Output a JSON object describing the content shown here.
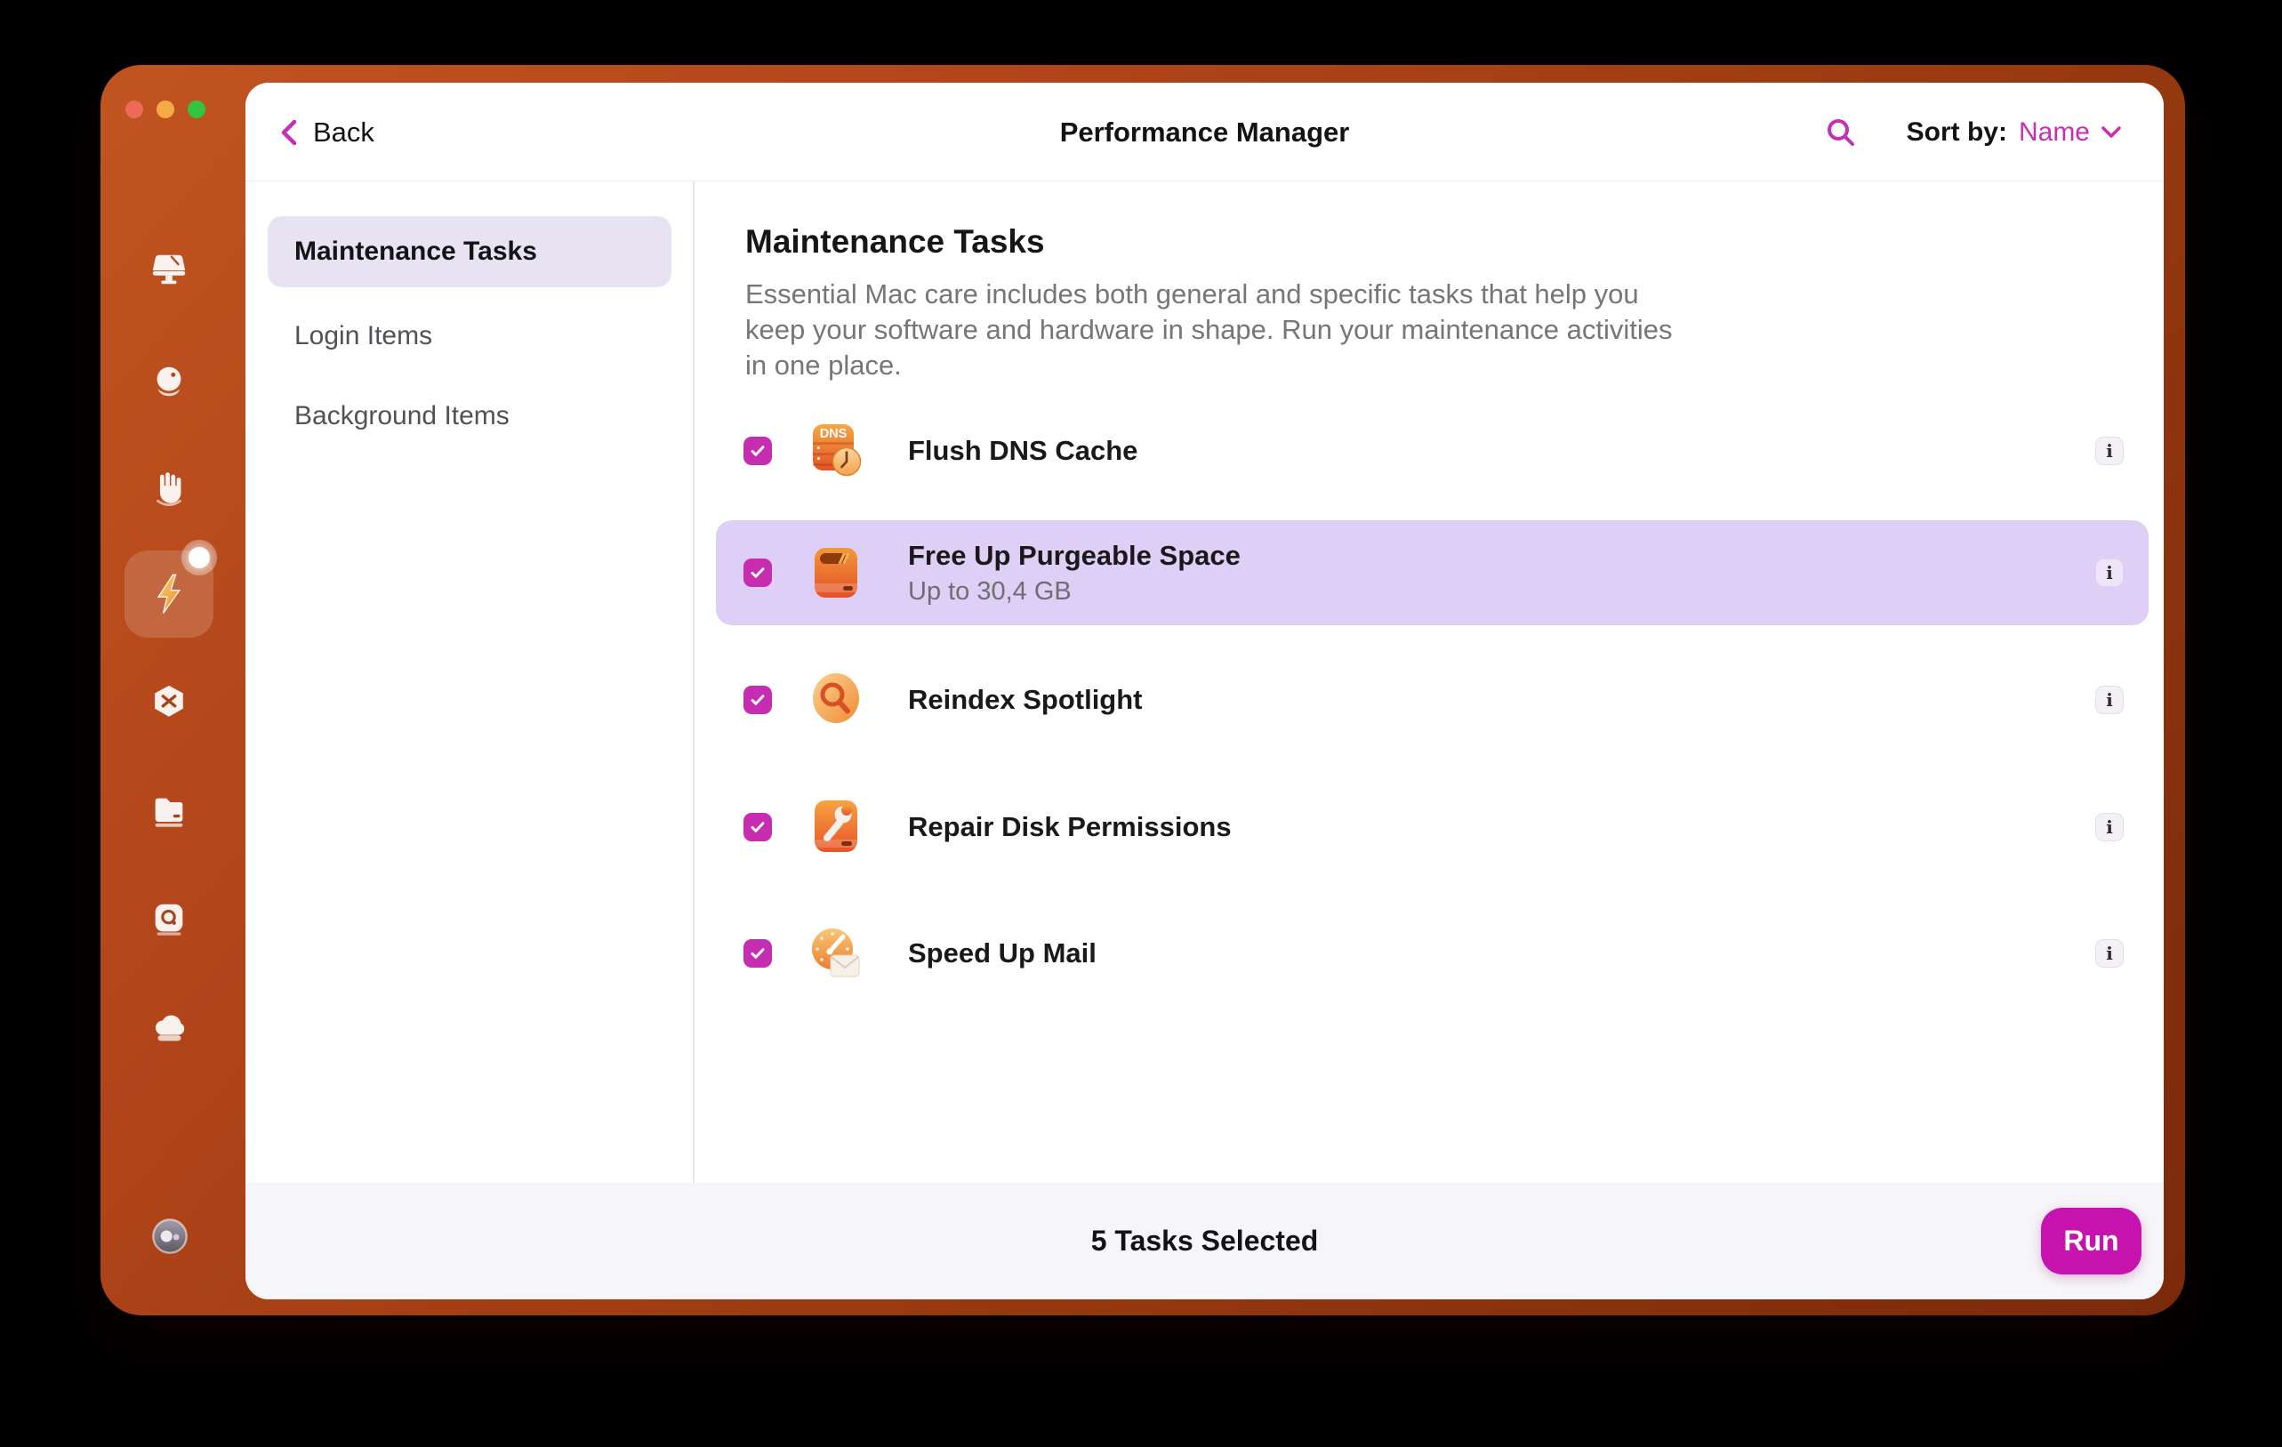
{
  "header": {
    "back_label": "Back",
    "title": "Performance Manager",
    "sort_label": "Sort by:",
    "sort_value": "Name"
  },
  "sidebar": {
    "items": [
      {
        "icon": "monitor-icon"
      },
      {
        "icon": "care-orb-icon"
      },
      {
        "icon": "protection-hand-icon"
      },
      {
        "icon": "performance-bolt-icon",
        "active": true,
        "badge": true
      },
      {
        "icon": "applications-icon"
      },
      {
        "icon": "files-folder-icon"
      },
      {
        "icon": "media-viewer-icon"
      },
      {
        "icon": "space-cloud-icon"
      },
      {
        "icon": "assistant-avatar-icon"
      }
    ]
  },
  "nav": {
    "items": [
      {
        "label": "Maintenance Tasks",
        "selected": true
      },
      {
        "label": "Login Items",
        "selected": false
      },
      {
        "label": "Background Items",
        "selected": false
      }
    ]
  },
  "main": {
    "heading": "Maintenance Tasks",
    "description": "Essential Mac care includes both general and specific tasks that help you keep your software and hardware in shape. Run your maintenance activities in one place.",
    "tasks": [
      {
        "label": "Flush DNS Cache",
        "subtitle": "",
        "icon": "dns-cache-icon",
        "checked": true,
        "highlighted": false
      },
      {
        "label": "Free Up Purgeable Space",
        "subtitle": "Up to 30,4 GB",
        "icon": "purgeable-space-icon",
        "checked": true,
        "highlighted": true
      },
      {
        "label": "Reindex Spotlight",
        "subtitle": "",
        "icon": "spotlight-icon",
        "checked": true,
        "highlighted": false
      },
      {
        "label": "Repair Disk Permissions",
        "subtitle": "",
        "icon": "disk-permissions-icon",
        "checked": true,
        "highlighted": false
      },
      {
        "label": "Speed Up Mail",
        "subtitle": "",
        "icon": "mail-speed-icon",
        "checked": true,
        "highlighted": false
      }
    ],
    "info_label": "i"
  },
  "icons": {
    "dns_label": "DNS"
  },
  "footer": {
    "status": "5 Tasks Selected",
    "run_label": "Run"
  },
  "colors": {
    "accent_magenta": "#c713ad",
    "checkbox_magenta": "#c72db1",
    "row_highlight_purple": "#decff6",
    "nav_selected_lavender": "#e7e3f2",
    "frame_orange_start": "#c05520",
    "frame_orange_end": "#7a2a0b",
    "footer_background": "#f6f5f9"
  }
}
